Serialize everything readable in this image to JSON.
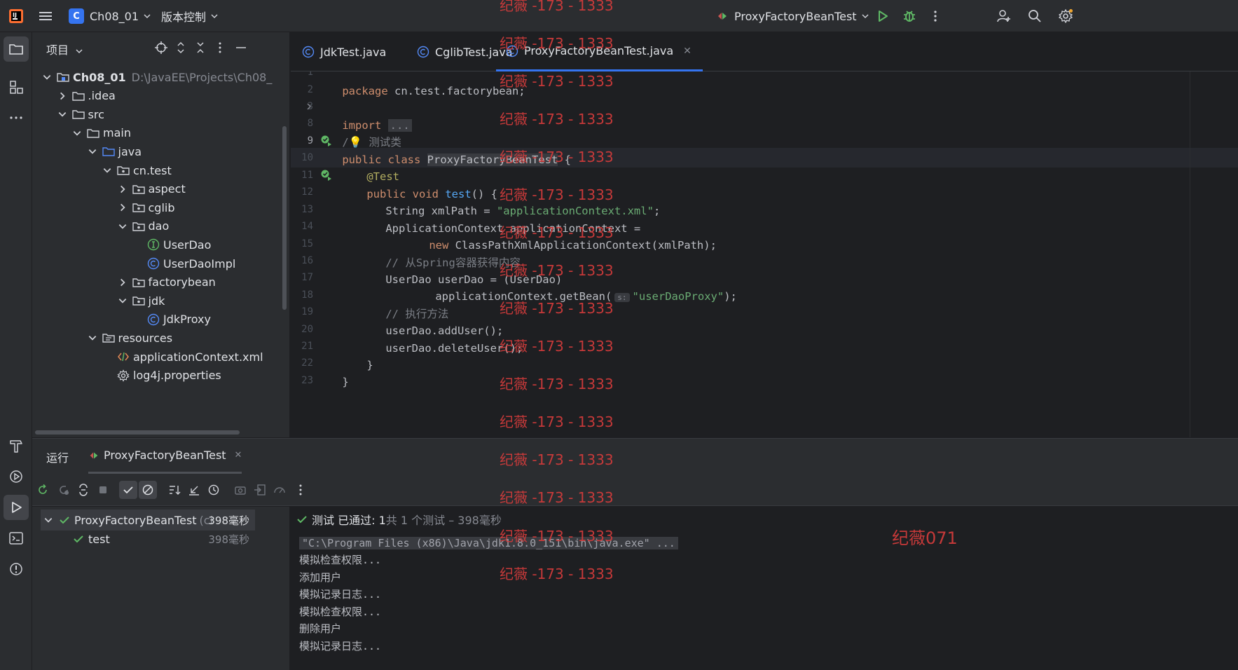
{
  "titlebar": {
    "project_badge": "C",
    "project_name": "Ch08_01",
    "vcs_menu": "版本控制",
    "run_config": "ProxyFactoryBeanTest"
  },
  "project_panel": {
    "title": "项目",
    "tree": [
      {
        "label": "Ch08_01",
        "detail": "D:\\JavaEE\\Projects\\Ch08_",
        "depth": 0,
        "expanded": true,
        "icon": "module-folder-icon"
      },
      {
        "label": ".idea",
        "depth": 1,
        "expanded": false,
        "icon": "folder-icon"
      },
      {
        "label": "src",
        "depth": 1,
        "expanded": true,
        "icon": "folder-icon"
      },
      {
        "label": "main",
        "depth": 2,
        "expanded": true,
        "icon": "folder-icon"
      },
      {
        "label": "java",
        "depth": 3,
        "expanded": true,
        "icon": "source-folder-icon"
      },
      {
        "label": "cn.test",
        "depth": 4,
        "expanded": true,
        "icon": "package-icon"
      },
      {
        "label": "aspect",
        "depth": 5,
        "expanded": false,
        "icon": "package-icon"
      },
      {
        "label": "cglib",
        "depth": 5,
        "expanded": false,
        "icon": "package-icon"
      },
      {
        "label": "dao",
        "depth": 5,
        "expanded": true,
        "icon": "package-icon"
      },
      {
        "label": "UserDao",
        "depth": 6,
        "icon": "interface-icon"
      },
      {
        "label": "UserDaoImpl",
        "depth": 6,
        "icon": "class-icon"
      },
      {
        "label": "factorybean",
        "depth": 5,
        "expanded": false,
        "icon": "package-icon"
      },
      {
        "label": "jdk",
        "depth": 5,
        "expanded": true,
        "icon": "package-icon"
      },
      {
        "label": "JdkProxy",
        "depth": 6,
        "icon": "class-icon"
      },
      {
        "label": "resources",
        "depth": 3,
        "expanded": true,
        "icon": "resources-folder-icon"
      },
      {
        "label": "applicationContext.xml",
        "depth": 4,
        "icon": "xml-file-icon"
      },
      {
        "label": "log4j.properties",
        "depth": 4,
        "icon": "properties-file-icon"
      }
    ]
  },
  "editor": {
    "tabs": [
      {
        "label": "JdkTest.java",
        "active": false
      },
      {
        "label": "CglibTest.java",
        "active": false
      },
      {
        "label": "ProxyFactoryBeanTest.java",
        "active": true
      }
    ],
    "line_numbers": [
      "1",
      "2",
      "3",
      "8",
      "9",
      "10",
      "11",
      "12",
      "13",
      "14",
      "15",
      "16",
      "17",
      "18",
      "19",
      "20",
      "21",
      "22",
      "23"
    ],
    "current_line": "9",
    "code": {
      "l1_kw": "package",
      "l1_rest": " cn.test.factorybean;",
      "l3_kw": "import",
      "l3_fold": "...",
      "l8_cmt1": "/",
      "l8_cmt2": " 测试类",
      "l9_kw": "public class",
      "l9_cls": "ProxyFactoryBeanTest",
      "l9_rest": " {",
      "l10_ann": "@Test",
      "l11_kw": "public void",
      "l11_fn": "test",
      "l11_rest": "() {",
      "l12_a": "String xmlPath = ",
      "l12_str": "\"applicationContext.xml\"",
      "l12_b": ";",
      "l13": "ApplicationContext applicationContext =",
      "l14_kw": "new",
      "l14_rest": " ClassPathXmlApplicationContext(xmlPath);",
      "l15_cmt": "// 从Spring容器获得内容",
      "l16": "UserDao userDao = (UserDao)",
      "l17_a": "applicationContext.getBean(",
      "l17_hint": "s:",
      "l17_str": "\"userDaoProxy\"",
      "l17_b": ");",
      "l18_cmt": "// 执行方法",
      "l19": "userDao.addUser();",
      "l20": "userDao.deleteUser();",
      "l21": "}",
      "l22": "}"
    }
  },
  "run_panel": {
    "label": "运行",
    "tab": "ProxyFactoryBeanTest",
    "test_tree": [
      {
        "label": "ProxyFactoryBeanTest",
        "suffix": "(ci",
        "time": "398毫秒"
      },
      {
        "label": "test",
        "time": "398毫秒"
      }
    ],
    "status_main": "测试 已通过: 1",
    "status_detail": "共 1 个测试 – 398毫秒",
    "console": [
      "\"C:\\Program Files (x86)\\Java\\jdk1.8.0_151\\bin\\java.exe\" ...",
      "模拟检查权限...",
      "添加用户",
      "模拟记录日志...",
      "模拟检查权限...",
      "删除用户",
      "模拟记录日志..."
    ]
  },
  "watermarks": {
    "repeat": "纪薇 -173 - 1333",
    "corner": "纪薇071"
  },
  "colors": {
    "accent": "#3574f0",
    "pass_green": "#5fb865",
    "watermark_red": "#d03b3b"
  }
}
